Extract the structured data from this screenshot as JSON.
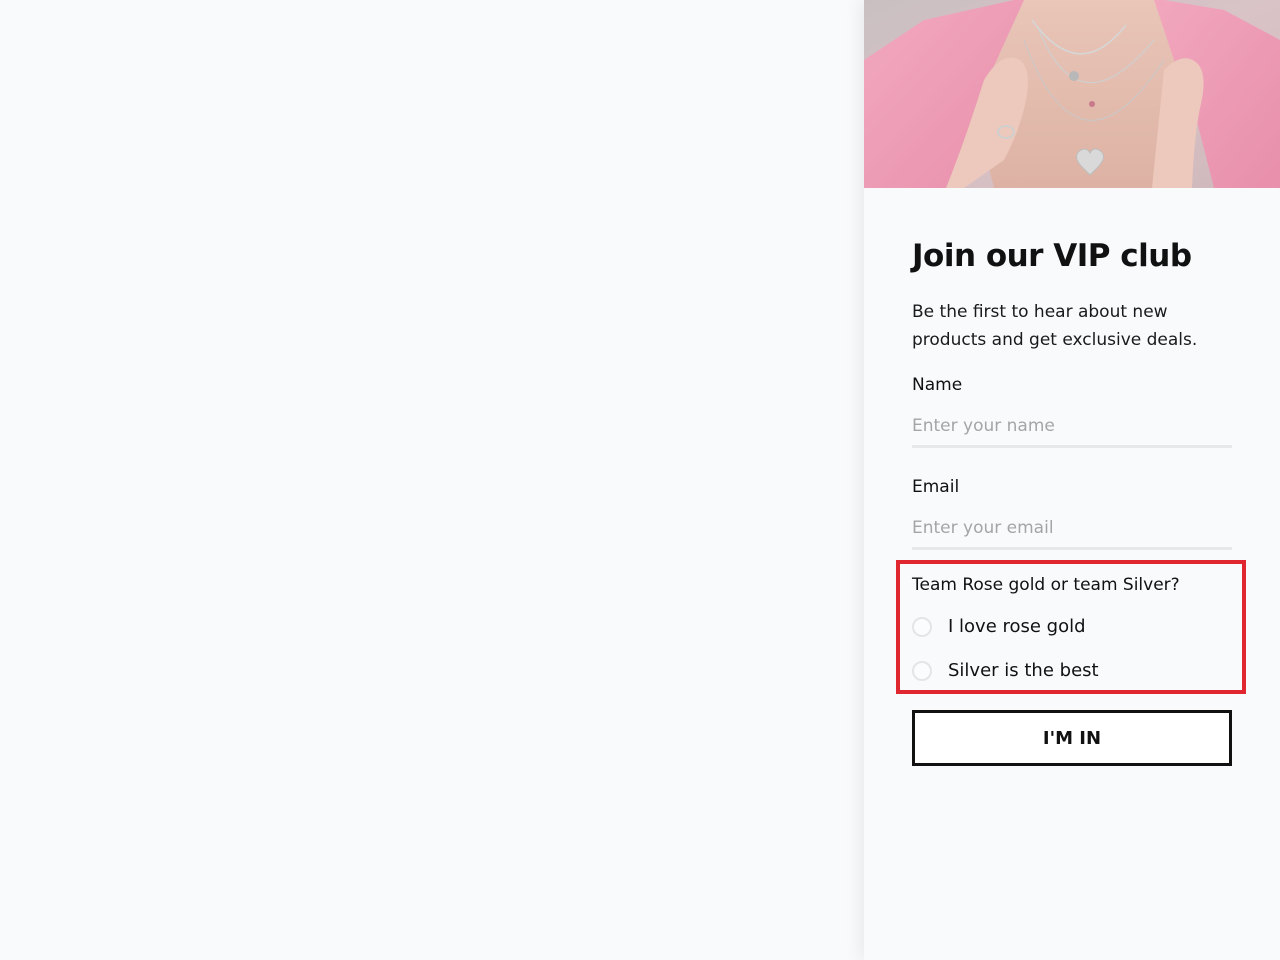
{
  "signup": {
    "title": "Join our VIP club",
    "subtitle": "Be the first to hear about new products and get exclusive deals.",
    "name_field": {
      "label": "Name",
      "placeholder": "Enter your name",
      "value": ""
    },
    "email_field": {
      "label": "Email",
      "placeholder": "Enter your email",
      "value": ""
    },
    "poll": {
      "question": "Team Rose gold or team Silver?",
      "options": [
        {
          "label": "I love rose gold"
        },
        {
          "label": "Silver is the best"
        }
      ]
    },
    "submit_label": "I'M IN"
  },
  "colors": {
    "page_background": "#f8fafc",
    "text": "#111111",
    "highlight_border": "#e0262f",
    "input_underline": "#e6e8ea",
    "placeholder": "#a3a5a8"
  }
}
